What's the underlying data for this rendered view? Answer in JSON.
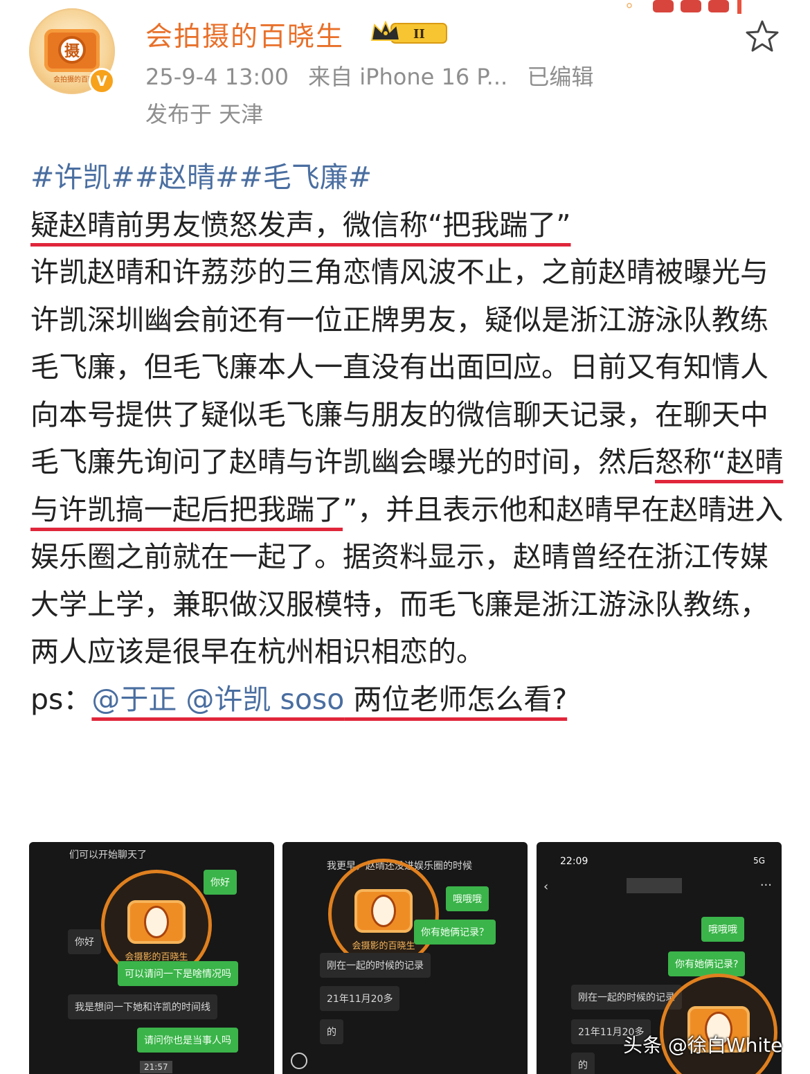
{
  "header": {
    "username": "会拍摄的百晓生",
    "level_badge": "II",
    "verified_badge": "V",
    "avatar_text": "会拍摄的百晓",
    "avatar_glyph": "摄",
    "time": "25-9-4 13:00",
    "source": "来自 iPhone 16 P...",
    "edited": "已编辑",
    "location": "发布于 天津"
  },
  "post": {
    "hashtags": "#许凯##赵晴##毛飞廉#",
    "headline": "疑赵晴前男友愤怒发声，微信称“把我踹了”",
    "body_a": "许凯赵晴和许荔莎的三角恋情风波不止，之前赵晴被曝光与许凯深圳幽会前还有一位正牌男友，疑似是浙江游泳队教练毛飞廉，但毛飞廉本人一直没有出面回应。日前又有知情人向本号提供了疑似毛飞廉与朋友的微信聊天记录，在聊天中毛飞廉先询问了赵晴与许凯幽会曝光的时间，然后",
    "body_quote": "怒称“赵晴与许凯搞一起后把我踹了",
    "body_b": "”，并且表示他和赵晴早在赵晴进入娱乐圈之前就在一起了。据资料显示，赵晴曾经在浙江传媒大学上学，兼职做汉服模特，而毛飞廉是浙江游泳队教练，两人应该是很早在杭州相识相恋的。",
    "ps_label": "ps：",
    "ps_mentions": "@于正 @许凯 soso",
    "ps_question": " 两位老师怎么看?"
  },
  "images": [
    {
      "watermark": "会摄影的百晓生",
      "messages": [
        {
          "side": "l",
          "text": "们可以开始聊天了"
        },
        {
          "side": "r",
          "text": "你好"
        },
        {
          "side": "l",
          "text": "你好"
        },
        {
          "side": "r",
          "text": "可以请问一下是啥情况吗"
        },
        {
          "side": "l",
          "text": "我是想问一下她和许凯的时间线"
        },
        {
          "side": "r",
          "text": "请问你也是当事人吗"
        }
      ],
      "time_stamp": "21:57"
    },
    {
      "watermark": "会摄影的百晓生",
      "messages": [
        {
          "side": "l",
          "text": "我更早，赵晴还没进娱乐圈的时候"
        },
        {
          "side": "r",
          "text": "哦哦哦"
        },
        {
          "side": "r",
          "text": "你有她俩记录？"
        },
        {
          "side": "l",
          "text": "刚在一起的时候的记录"
        },
        {
          "side": "l",
          "text": "21年11月20多"
        },
        {
          "side": "l",
          "text": "的"
        }
      ]
    },
    {
      "status_time": "22:09",
      "status_net": "5G",
      "messages": [
        {
          "side": "r",
          "text": "哦哦哦"
        },
        {
          "side": "r",
          "text": "你有她俩记录?"
        },
        {
          "side": "l",
          "text": "刚在一起的时候的记录"
        },
        {
          "side": "l",
          "text": "21年11月20多"
        },
        {
          "side": "l",
          "text": "的"
        }
      ]
    }
  ],
  "footer_watermark": "头条 @徐白White",
  "colors": {
    "username": "#e8702a",
    "link": "#4a6ea0",
    "underline": "#e0263a",
    "wechat_green": "#3bb44a"
  }
}
